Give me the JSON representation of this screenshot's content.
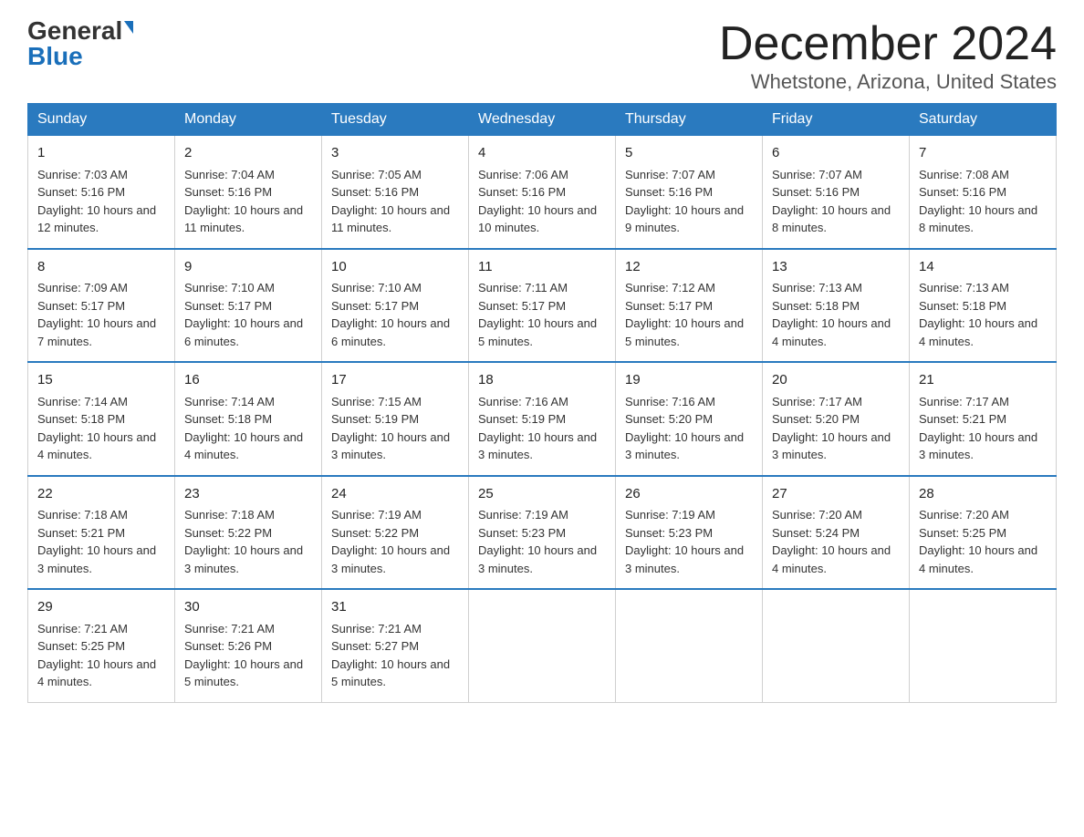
{
  "header": {
    "logo_general": "General",
    "logo_blue": "Blue",
    "title": "December 2024",
    "subtitle": "Whetstone, Arizona, United States"
  },
  "days_of_week": [
    "Sunday",
    "Monday",
    "Tuesday",
    "Wednesday",
    "Thursday",
    "Friday",
    "Saturday"
  ],
  "weeks": [
    [
      {
        "day": 1,
        "sunrise": "7:03 AM",
        "sunset": "5:16 PM",
        "daylight": "10 hours and 12 minutes."
      },
      {
        "day": 2,
        "sunrise": "7:04 AM",
        "sunset": "5:16 PM",
        "daylight": "10 hours and 11 minutes."
      },
      {
        "day": 3,
        "sunrise": "7:05 AM",
        "sunset": "5:16 PM",
        "daylight": "10 hours and 11 minutes."
      },
      {
        "day": 4,
        "sunrise": "7:06 AM",
        "sunset": "5:16 PM",
        "daylight": "10 hours and 10 minutes."
      },
      {
        "day": 5,
        "sunrise": "7:07 AM",
        "sunset": "5:16 PM",
        "daylight": "10 hours and 9 minutes."
      },
      {
        "day": 6,
        "sunrise": "7:07 AM",
        "sunset": "5:16 PM",
        "daylight": "10 hours and 8 minutes."
      },
      {
        "day": 7,
        "sunrise": "7:08 AM",
        "sunset": "5:16 PM",
        "daylight": "10 hours and 8 minutes."
      }
    ],
    [
      {
        "day": 8,
        "sunrise": "7:09 AM",
        "sunset": "5:17 PM",
        "daylight": "10 hours and 7 minutes."
      },
      {
        "day": 9,
        "sunrise": "7:10 AM",
        "sunset": "5:17 PM",
        "daylight": "10 hours and 6 minutes."
      },
      {
        "day": 10,
        "sunrise": "7:10 AM",
        "sunset": "5:17 PM",
        "daylight": "10 hours and 6 minutes."
      },
      {
        "day": 11,
        "sunrise": "7:11 AM",
        "sunset": "5:17 PM",
        "daylight": "10 hours and 5 minutes."
      },
      {
        "day": 12,
        "sunrise": "7:12 AM",
        "sunset": "5:17 PM",
        "daylight": "10 hours and 5 minutes."
      },
      {
        "day": 13,
        "sunrise": "7:13 AM",
        "sunset": "5:18 PM",
        "daylight": "10 hours and 4 minutes."
      },
      {
        "day": 14,
        "sunrise": "7:13 AM",
        "sunset": "5:18 PM",
        "daylight": "10 hours and 4 minutes."
      }
    ],
    [
      {
        "day": 15,
        "sunrise": "7:14 AM",
        "sunset": "5:18 PM",
        "daylight": "10 hours and 4 minutes."
      },
      {
        "day": 16,
        "sunrise": "7:14 AM",
        "sunset": "5:18 PM",
        "daylight": "10 hours and 4 minutes."
      },
      {
        "day": 17,
        "sunrise": "7:15 AM",
        "sunset": "5:19 PM",
        "daylight": "10 hours and 3 minutes."
      },
      {
        "day": 18,
        "sunrise": "7:16 AM",
        "sunset": "5:19 PM",
        "daylight": "10 hours and 3 minutes."
      },
      {
        "day": 19,
        "sunrise": "7:16 AM",
        "sunset": "5:20 PM",
        "daylight": "10 hours and 3 minutes."
      },
      {
        "day": 20,
        "sunrise": "7:17 AM",
        "sunset": "5:20 PM",
        "daylight": "10 hours and 3 minutes."
      },
      {
        "day": 21,
        "sunrise": "7:17 AM",
        "sunset": "5:21 PM",
        "daylight": "10 hours and 3 minutes."
      }
    ],
    [
      {
        "day": 22,
        "sunrise": "7:18 AM",
        "sunset": "5:21 PM",
        "daylight": "10 hours and 3 minutes."
      },
      {
        "day": 23,
        "sunrise": "7:18 AM",
        "sunset": "5:22 PM",
        "daylight": "10 hours and 3 minutes."
      },
      {
        "day": 24,
        "sunrise": "7:19 AM",
        "sunset": "5:22 PM",
        "daylight": "10 hours and 3 minutes."
      },
      {
        "day": 25,
        "sunrise": "7:19 AM",
        "sunset": "5:23 PM",
        "daylight": "10 hours and 3 minutes."
      },
      {
        "day": 26,
        "sunrise": "7:19 AM",
        "sunset": "5:23 PM",
        "daylight": "10 hours and 3 minutes."
      },
      {
        "day": 27,
        "sunrise": "7:20 AM",
        "sunset": "5:24 PM",
        "daylight": "10 hours and 4 minutes."
      },
      {
        "day": 28,
        "sunrise": "7:20 AM",
        "sunset": "5:25 PM",
        "daylight": "10 hours and 4 minutes."
      }
    ],
    [
      {
        "day": 29,
        "sunrise": "7:21 AM",
        "sunset": "5:25 PM",
        "daylight": "10 hours and 4 minutes."
      },
      {
        "day": 30,
        "sunrise": "7:21 AM",
        "sunset": "5:26 PM",
        "daylight": "10 hours and 5 minutes."
      },
      {
        "day": 31,
        "sunrise": "7:21 AM",
        "sunset": "5:27 PM",
        "daylight": "10 hours and 5 minutes."
      },
      null,
      null,
      null,
      null
    ]
  ],
  "labels": {
    "sunrise": "Sunrise:",
    "sunset": "Sunset:",
    "daylight": "Daylight:"
  }
}
